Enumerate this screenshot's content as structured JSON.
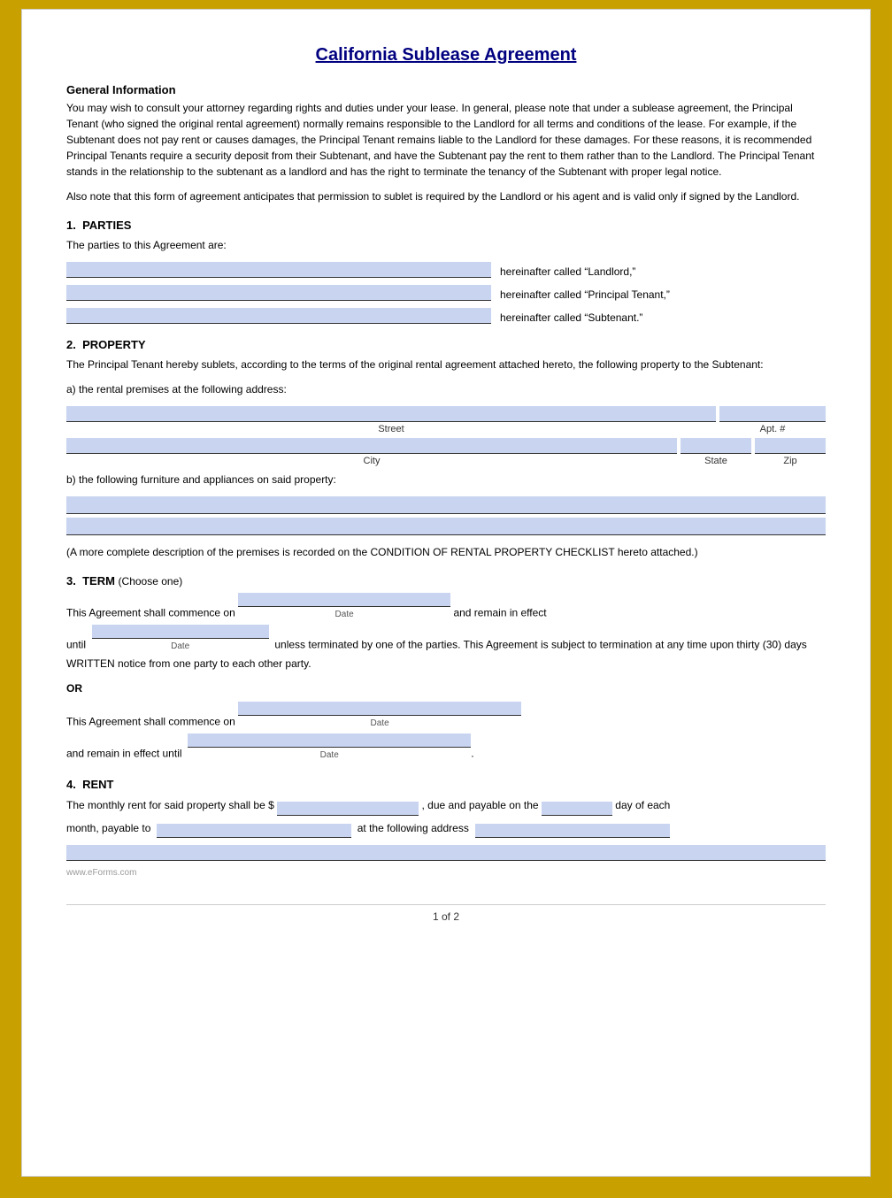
{
  "document": {
    "title": "California Sublease Agreement",
    "general_info_heading": "General Information",
    "general_info_text": "You may wish to consult your attorney regarding rights and duties under your lease. In general, please note that under a sublease agreement, the Principal Tenant (who signed the original rental agreement) normally remains responsible to the Landlord for all terms and conditions of the lease. For example, if the Subtenant does not pay rent or causes damages, the Principal Tenant remains liable to the Landlord for these damages. For these reasons, it is recommended Principal Tenants require a security deposit from their Subtenant, and have the Subtenant pay the rent to them rather than to the Landlord. The Principal Tenant stands in the relationship to the subtenant as a landlord and has the right to terminate the tenancy of the Subtenant with proper legal notice.",
    "also_note_text": "Also note that this form of agreement anticipates that permission to sublet is required by the Landlord or his agent and is valid only if signed by the Landlord.",
    "section1": {
      "number": "1.",
      "title": "PARTIES",
      "intro": "The parties to this Agreement are:",
      "landlord_label": "hereinafter called “Landlord,”",
      "tenant_label": "hereinafter called “Principal Tenant,”",
      "subtenant_label": "hereinafter called “Subtenant.”"
    },
    "section2": {
      "number": "2.",
      "title": "PROPERTY",
      "intro": "The Principal Tenant hereby sublets, according to the terms of the original rental agreement attached hereto, the following property to the Subtenant:",
      "sub_a": "a)  the rental premises at the following address:",
      "street_label": "Street",
      "apt_label": "Apt. #",
      "city_label": "City",
      "state_label": "State",
      "zip_label": "Zip",
      "sub_b": "b)  the following furniture and appliances on said property:",
      "condition_text": "(A more complete description of the premises is recorded on the CONDITION OF RENTAL PROPERTY CHECKLIST hereto attached.)"
    },
    "section3": {
      "number": "3.",
      "title": "TERM",
      "choose": "(Choose one)",
      "line1": "This Agreement shall commence on",
      "date_label": "Date",
      "and_remain": "and remain in effect",
      "until_text": "until",
      "unless_text": "unless terminated by one of the parties. This Agreement is subject to termination at any time upon thirty (30) days WRITTEN notice from one party to each other party.",
      "or_text": "OR",
      "line2": "This Agreement shall commence on",
      "and_remain2": "and remain in effect until",
      "date_label2": "Date",
      "date_label3": "Date"
    },
    "section4": {
      "number": "4.",
      "title": "RENT",
      "line1_start": "The monthly rent for said property shall be $",
      "line1_mid": ", due and payable on the",
      "line1_end": "day of each",
      "line2_start": "month, payable to",
      "line2_mid": "at the following address",
      "line2_end": ""
    },
    "footer": {
      "page_label": "1 of 2"
    },
    "watermark": "www.eForms.com"
  }
}
